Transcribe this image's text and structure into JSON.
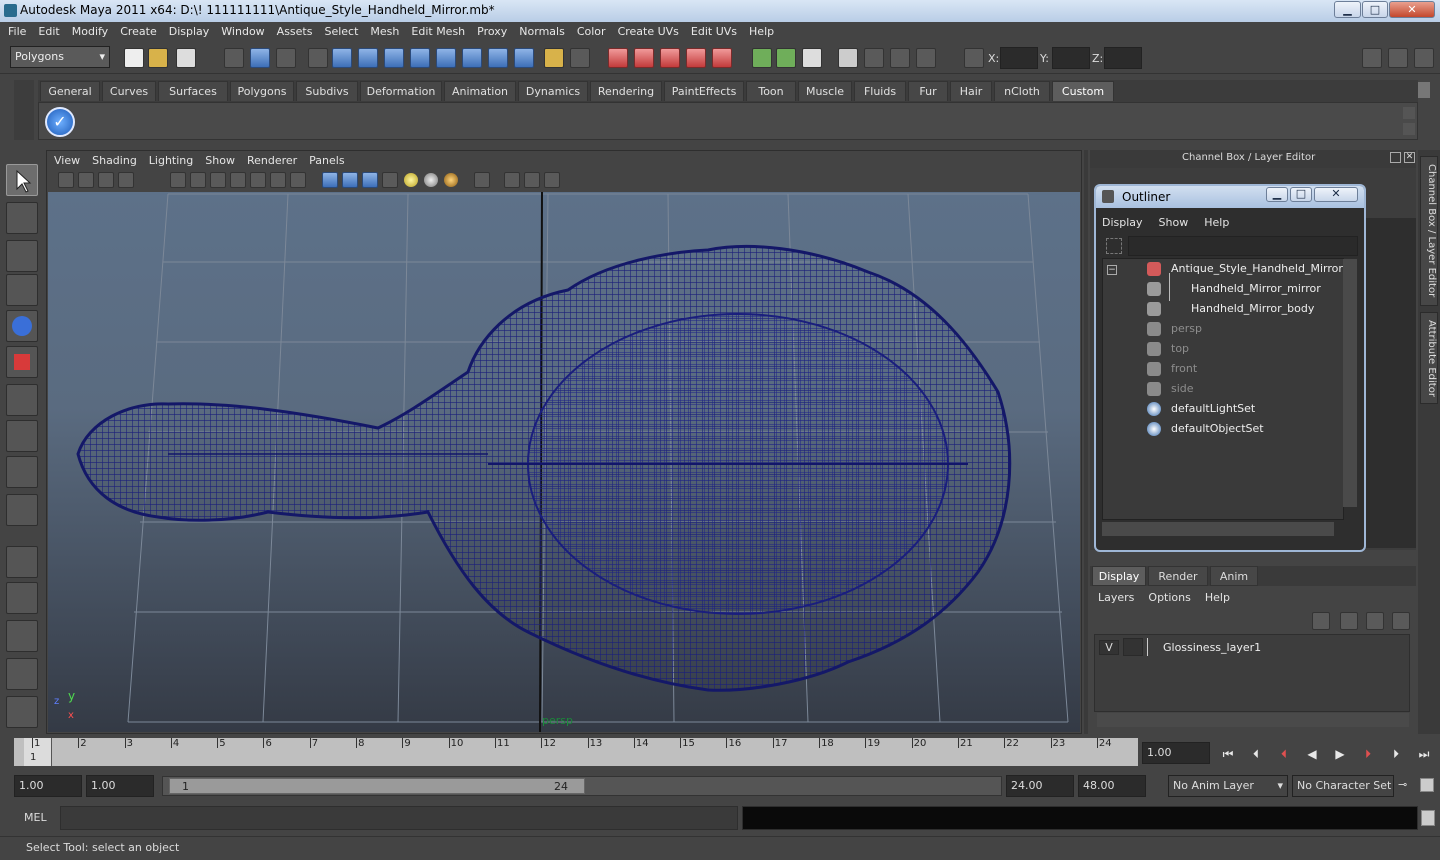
{
  "window": {
    "title": "Autodesk Maya 2011 x64: D:\\! 111111111\\Antique_Style_Handheld_Mirror.mb*",
    "minimize": "▁",
    "maximize": "□",
    "close": "✕"
  },
  "menubar": [
    "File",
    "Edit",
    "Modify",
    "Create",
    "Display",
    "Window",
    "Assets",
    "Select",
    "Mesh",
    "Edit Mesh",
    "Proxy",
    "Normals",
    "Color",
    "Create UVs",
    "Edit UVs",
    "Help"
  ],
  "status": {
    "menu_set": "Polygons",
    "x_label": "X:",
    "y_label": "Y:",
    "z_label": "Z:"
  },
  "shelf": {
    "tabs": [
      "General",
      "Curves",
      "Surfaces",
      "Polygons",
      "Subdivs",
      "Deformation",
      "Animation",
      "Dynamics",
      "Rendering",
      "PaintEffects",
      "Toon",
      "Muscle",
      "Fluids",
      "Fur",
      "Hair",
      "nCloth",
      "Custom"
    ],
    "active": "Custom"
  },
  "viewport": {
    "menus": [
      "View",
      "Shading",
      "Lighting",
      "Show",
      "Renderer",
      "Panels"
    ],
    "camera_label": "persp",
    "axis_y": "y",
    "axis_x": "x",
    "axis_z": "z"
  },
  "right_panel": {
    "header": "Channel Box / Layer Editor",
    "vtab_channel": "Channel Box / Layer Editor",
    "vtab_attr": "Attribute Editor"
  },
  "outliner": {
    "title": "Outliner",
    "menus": [
      "Display",
      "Show",
      "Help"
    ],
    "items": [
      {
        "label": "Antique_Style_Handheld_Mirror",
        "dim": false
      },
      {
        "label": "Handheld_Mirror_mirror",
        "dim": false
      },
      {
        "label": "Handheld_Mirror_body",
        "dim": false
      },
      {
        "label": "persp",
        "dim": true
      },
      {
        "label": "top",
        "dim": true
      },
      {
        "label": "front",
        "dim": true
      },
      {
        "label": "side",
        "dim": true
      },
      {
        "label": "defaultLightSet",
        "dim": false
      },
      {
        "label": "defaultObjectSet",
        "dim": false
      }
    ]
  },
  "layer_editor": {
    "tabs": [
      "Display",
      "Render",
      "Anim"
    ],
    "active": "Display",
    "menus": [
      "Layers",
      "Options",
      "Help"
    ],
    "layer": {
      "visible": "V",
      "name": "Glossiness_layer1"
    }
  },
  "timeline": {
    "ticks": [
      "1",
      "2",
      "3",
      "4",
      "5",
      "6",
      "7",
      "8",
      "9",
      "10",
      "11",
      "12",
      "13",
      "14",
      "15",
      "16",
      "17",
      "18",
      "19",
      "20",
      "21",
      "22",
      "23",
      "24"
    ],
    "current_frame": "1",
    "frame_field": "1.00"
  },
  "range": {
    "start": "1.00",
    "start_inner": "1.00",
    "slider_start": "1",
    "slider_end": "24",
    "end_inner": "24.00",
    "end": "48.00",
    "anim_layer": "No Anim Layer",
    "char_set": "No Character Set"
  },
  "cmd": {
    "label": "MEL"
  },
  "help_line": "Select Tool: select an object",
  "colors": {
    "wire": "#1b1f7a",
    "accent": "#5d5d5d"
  }
}
